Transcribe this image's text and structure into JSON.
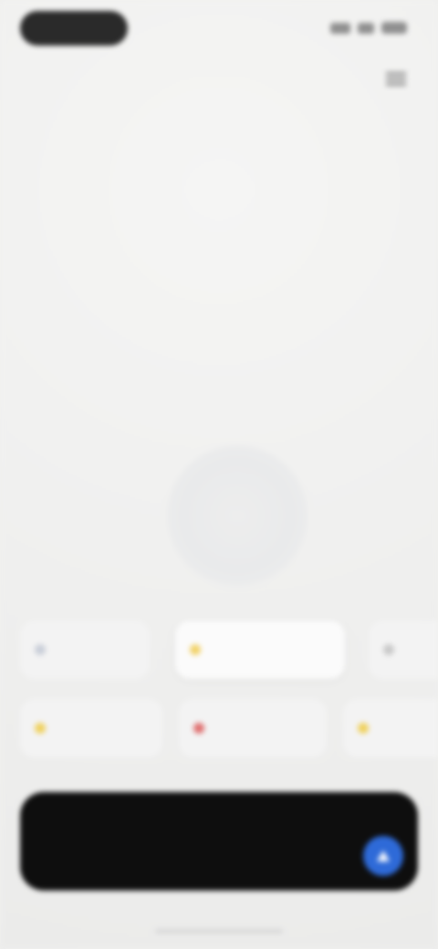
{
  "status_bar": {
    "time": ""
  },
  "hero": {
    "title": "",
    "subtitle": ""
  },
  "suggestions_row_1": [
    {
      "label": "",
      "dot_color": "#c9ced8"
    },
    {
      "label": "",
      "dot_color": "#f2d26a"
    },
    {
      "label": "",
      "dot_color": "#c8c8c8"
    }
  ],
  "suggestions_row_2": [
    {
      "label": "",
      "dot_color": "#f0d15e"
    },
    {
      "label": "",
      "dot_color": "#e07070"
    },
    {
      "label": "",
      "dot_color": "#f0d15e"
    }
  ],
  "input": {
    "placeholder": ""
  },
  "colors": {
    "send_button": "#2e6ad8",
    "input_bar": "#0e0e0e",
    "background": "#efefee"
  },
  "icons": {
    "menu": "menu-icon",
    "send": "send-icon"
  }
}
